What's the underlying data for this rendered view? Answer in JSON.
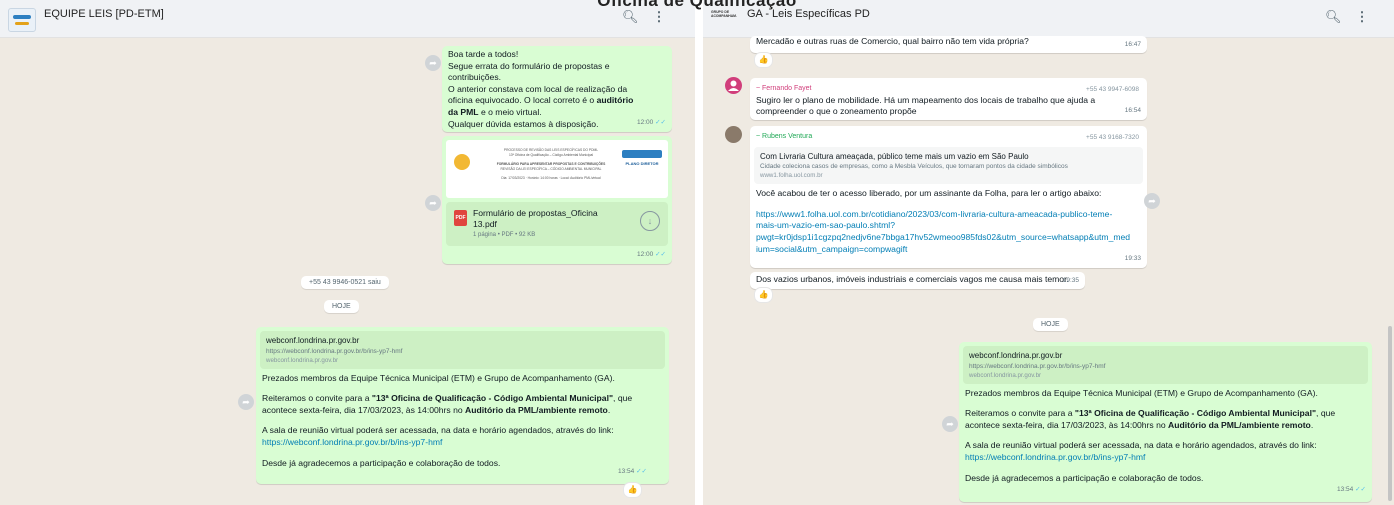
{
  "page": {
    "overlay_title": "Oficina de Qualificação"
  },
  "left": {
    "header": {
      "title": "EQUIPE LEIS [PD-ETM]",
      "search_icon": "search-icon",
      "menu_icon": "menu-dots-icon"
    },
    "msg1": {
      "lines": [
        "Boa tarde a todos!",
        "Segue errata do formulário de propostas e",
        "contribuições.",
        "O anterior constava com local de realização da",
        "oficina equivocado. O local correto é o"
      ],
      "bold1": "auditório",
      "bold2": "da PML",
      "tail": " e o meio virtual.",
      "last": "Qualquer dúvida estamos à disposição.",
      "time": "12:00"
    },
    "doc": {
      "thumb_line1": "PROCESSO DE REVISÃO DAS LEIS ESPECÍFICAS DO PDML",
      "thumb_line2": "13ª Oficina de Qualificação – Código Ambiental Municipal",
      "thumb_line3": "FORMULÁRIO PARA APRESENTAR PROPOSTAS E CONTRIBUIÇÕES",
      "thumb_line4": "REVISÃO DA LEI ESPECÍFICA – CÓDIGO AMBIENTAL MUNICIPAL",
      "thumb_line5": "Dia: 17/03/2023 · Horário: 14:00 horas · Local: Auditório PML/virtual",
      "thumb_logo": "PLANO DIRETOR",
      "name_line1": "Formulário de propostas_Oficina",
      "name_line2": "13.pdf",
      "meta": "1 página • PDF • 92 KB",
      "time": "12:00"
    },
    "sys_left": "+55 43 9946-0521 saiu",
    "today": "HOJE",
    "msg2": {
      "preview_title": "webconf.londrina.pr.gov.br",
      "preview_desc": "https://webconf.londrina.pr.gov.br/b/ins-yp7-hmf",
      "preview_domain": "webconf.londrina.pr.gov.br",
      "p1": "Prezados membros da Equipe Técnica Municipal (ETM) e Grupo de Acompanhamento (GA).",
      "p2a": "Reiteramos o convite para a ",
      "p2b": "\"13ª Oficina de Qualificação - Código Ambiental Municipal\"",
      "p2c": ", que",
      "p2d": "acontece sexta-feira, dia 17/03/2023, às 14:00hrs no ",
      "p2e": "Auditório da PML/ambiente remoto",
      "p2f": ".",
      "p3": "A sala de reunião virtual poderá ser acessada, na data e horário agendados, através do link:",
      "link": "https://webconf.londrina.pr.gov.br/b/ins-yp7-hmf",
      "p4": "Desde já agradecemos a participação e colaboração de todos.",
      "time": "13:54",
      "reaction": "👍"
    }
  },
  "right": {
    "header": {
      "logo_text": "GRUPO DE ACOMPANHAM.",
      "title": "GA - Leis Específicas PD",
      "search_icon": "search-icon",
      "menu_icon": "menu-dots-icon"
    },
    "m0": {
      "text": "Mercadão e outras ruas de Comercio, qual bairro não tem vida própria?",
      "time": "16:47",
      "reaction": "👍"
    },
    "m1": {
      "sender": "~ Fernando Fayet",
      "phone": "+55 43 9947-6098",
      "text1": "Sugiro ler o plano de mobilidade. Há um mapeamento dos locais de trabalho que ajuda a",
      "text2": "compreender o que o zoneamento propõe",
      "time": "16:54",
      "sender_color": "#d13e7b"
    },
    "m2": {
      "sender": "~ Rubens Ventura",
      "phone": "+55 43 9168-7320",
      "preview_title": "Com Livraria Cultura ameaçada, público teme mais um vazio em São Paulo",
      "preview_desc": "Cidade coleciona casos de empresas, como a Mesbla Veículos, que tornaram pontos da cidade simbólicos",
      "preview_domain": "www1.folha.uol.com.br",
      "text": "Você acabou de ter o acesso liberado, por um assinante da Folha, para ler o artigo abaixo:",
      "link1": "https://www1.folha.uol.com.br/cotidiano/2023/03/com-livraria-cultura-ameacada-publico-teme-",
      "link2": "mais-um-vazio-em-sao-paulo.shtml?",
      "link3": "pwgt=kr0jdsp1i1cgzpq2nedjv6ne7bbga17hv52wmeoo985fds02&utm_source=whatsapp&utm_med",
      "link4": "ium=social&utm_campaign=compwagift",
      "time": "19:33",
      "sender_color": "#1fa855"
    },
    "m3": {
      "text": "Dos vazios urbanos, imóveis industriais e comerciais vagos me causa mais temor.",
      "time": "19:35",
      "reaction": "👍"
    },
    "today": "HOJE",
    "msg2": {
      "preview_title": "webconf.londrina.pr.gov.br",
      "preview_desc": "https://webconf.londrina.pr.gov.br/b/ins-yp7-hmf",
      "preview_domain": "webconf.londrina.pr.gov.br",
      "p1": "Prezados membros da Equipe Técnica Municipal (ETM) e Grupo de Acompanhamento (GA).",
      "p2a": "Reiteramos o convite para a ",
      "p2b": "\"13ª Oficina de Qualificação - Código Ambiental Municipal\"",
      "p2c": ", que",
      "p2d": "acontece sexta-feira, dia 17/03/2023, às 14:00hrs no ",
      "p2e": "Auditório da PML/ambiente remoto",
      "p2f": ".",
      "p3": "A sala de reunião virtual poderá ser acessada, na data e horário agendados, através do link:",
      "link": "https://webconf.londrina.pr.gov.br/b/ins-yp7-hmf",
      "p4": "Desde já agradecemos a participação e colaboração de todos.",
      "time": "13:54"
    }
  },
  "icons": {
    "forward": "forward-icon",
    "download": "download-icon",
    "pdf": "pdf-icon",
    "ticks": "double-check-icon"
  },
  "colors": {
    "header_bg": "#f0f2f5",
    "chat_bg": "#efeae2",
    "outgoing_bubble": "#d9fdd3",
    "incoming_bubble": "#ffffff",
    "link": "#027eb5"
  }
}
